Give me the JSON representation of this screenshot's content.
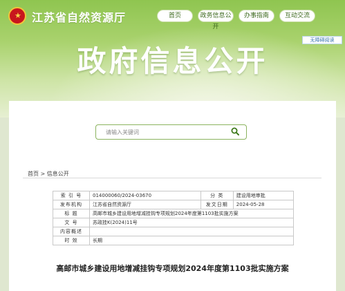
{
  "header": {
    "emblem_glyph": "★",
    "site_title": "江苏省自然资源厅",
    "nav": [
      "首页",
      "政务信息公开",
      "办事指南",
      "互动交流"
    ],
    "barrier_free": "无障碍阅读"
  },
  "hero_title": "政府信息公开",
  "search": {
    "placeholder": "请输入关键词"
  },
  "breadcrumb": "首页 > 信息公开",
  "metadata": {
    "index_label": "索 引 号",
    "index_value": "014000060/2024-03670",
    "category_label": "分 类",
    "category_value": "建设用地审批",
    "issuer_label": "发布机构",
    "issuer_value": "江苏省自然资源厅",
    "date_label": "发文日期",
    "date_value": "2024-05-28",
    "title_label": "标 题",
    "title_value": "高邮市城乡建设用地增减挂钩专项规划2024年度第1103批实施方案",
    "docno_label": "文 号",
    "docno_value": "苏政挂K(2024)11号",
    "summary_label": "内容概述",
    "summary_value": "",
    "validity_label": "时 效",
    "validity_value": "长期"
  },
  "document_title": "高邮市城乡建设用地增减挂钩专项规划2024年度第1103批实施方案",
  "colors": {
    "accent_green": "#8fc550",
    "emblem_red": "#c8161d"
  }
}
